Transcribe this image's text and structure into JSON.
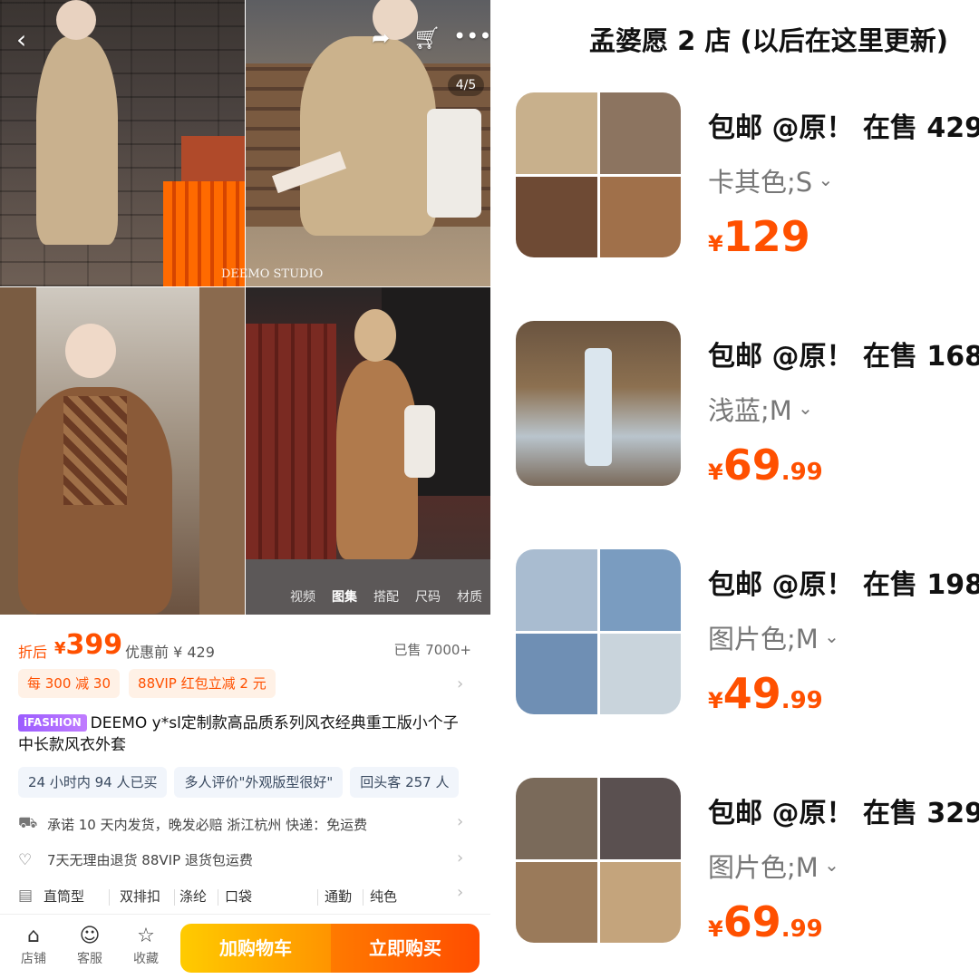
{
  "gallery": {
    "pager": "4/5",
    "tabs": [
      "视频",
      "图集",
      "搭配",
      "尺码",
      "材质"
    ],
    "active_tab": "图集",
    "watermark": "DEEMO STUDIO"
  },
  "price": {
    "after_label": "折后",
    "currency": "¥",
    "final": "399",
    "before_label": "优惠前",
    "before_value": "¥ 429",
    "sold": "已售 7000+"
  },
  "coupons": [
    "每 300 减 30",
    "88VIP 红包立减 2 元"
  ],
  "product": {
    "badge": "iFASHION",
    "title": "DEEMO y*sl定制款高品质系列风衣经典重工版小个子中长款风衣外套"
  },
  "chips": [
    "24 小时内 94 人已买",
    "多人评价\"外观版型很好\"",
    "回头客 257 人"
  ],
  "services": [
    {
      "icon": "truck-icon",
      "text": "承诺 10 天内发货，晚发必赔  浙江杭州  快递：免运费"
    },
    {
      "icon": "heart-icon",
      "text": "7天无理由退货   88VIP 退货包运费"
    }
  ],
  "attributes": [
    "直筒型",
    "双排扣",
    "涤纶",
    "口袋",
    "通勤",
    "纯色"
  ],
  "bottom": {
    "shop": "店铺",
    "service": "客服",
    "favorite": "收藏",
    "add_cart": "加购物车",
    "buy_now": "立即购买"
  },
  "right": {
    "shop_title": "孟婆愿 2 店 (以后在这里更新)",
    "items": [
      {
        "title": "包邮 @原！ 在售 429",
        "sku": "卡其色;S",
        "currency": "¥",
        "price_int": "129",
        "price_dec": ""
      },
      {
        "title": "包邮 @原！ 在售 168",
        "sku": "浅蓝;M",
        "currency": "¥",
        "price_int": "69",
        "price_dec": ".99"
      },
      {
        "title": "包邮 @原！ 在售 198",
        "sku": "图片色;M",
        "currency": "¥",
        "price_int": "49",
        "price_dec": ".99"
      },
      {
        "title": "包邮 @原！ 在售 329",
        "sku": "图片色;M",
        "currency": "¥",
        "price_int": "69",
        "price_dec": ".99"
      }
    ]
  },
  "colors": {
    "accent": "#ff5000",
    "cart": "#ffb300",
    "buy": "#ff5a00"
  }
}
